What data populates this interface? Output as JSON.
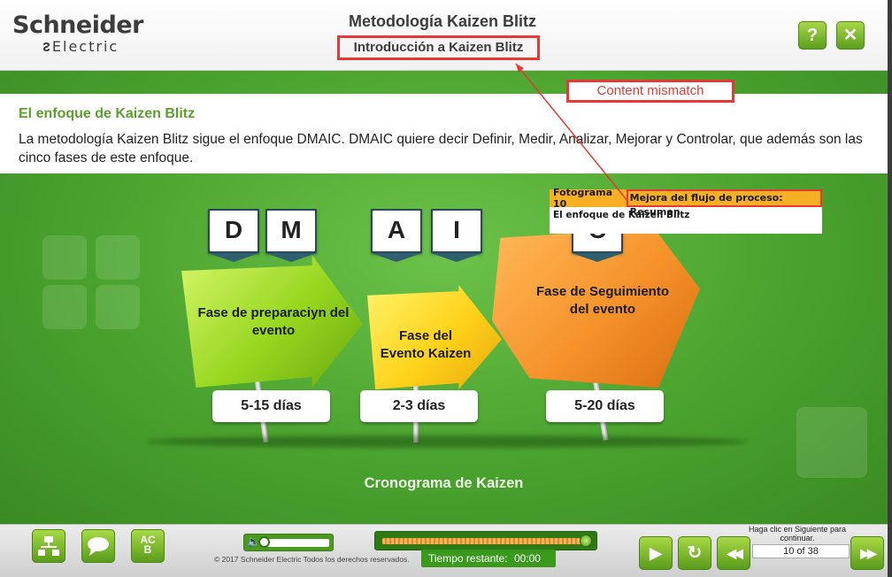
{
  "header": {
    "logo_line1": "Schneider",
    "logo_line2": "Electric",
    "course_title": "Metodología Kaizen Blitz",
    "slide_title": "Introducción a Kaizen Blitz",
    "help_label": "?",
    "close_label": "✕"
  },
  "annotation": {
    "label": "Content mismatch",
    "color": "#e53935"
  },
  "intro": {
    "heading": "El enfoque de Kaizen Blitz",
    "body": "La metodología Kaizen Blitz sigue el enfoque DMAIC. DMAIC quiere decir Definir, Medir, Analizar, Mejorar y Controlar, que además son las cinco fases de este enfoque."
  },
  "diagram": {
    "letters": [
      "D",
      "M",
      "A",
      "I",
      "C"
    ],
    "phases": [
      {
        "label": "Fase de preparaciyn del evento",
        "duration": "5-15 días",
        "color": "#95d61e"
      },
      {
        "label": "Fase del Evento Kaizen",
        "duration": "2-3 días",
        "color": "#ffd21a"
      },
      {
        "label": "Fase de Seguimiento del evento",
        "duration": "5-20 días",
        "color": "#f5922a"
      }
    ],
    "caption": "Cronograma de Kaizen"
  },
  "overlay": {
    "frame_label": "Fotograma 10",
    "frame_title": "Mejora del flujo de proceso: Resumen",
    "frame_subtitle": "El enfoque de Kaizen Blitz"
  },
  "footer": {
    "glossary_label_top": "AC",
    "glossary_label_bottom": "B",
    "copyright": "© 2017 Schneider Electric Todos los derechos reservados.",
    "time_label": "Tiempo restante:",
    "time_value": "00:00",
    "hint": "Haga clic en Siguiente para continuar.",
    "page_indicator": "10 of 38",
    "progress": 1.0,
    "volume": 0.0
  },
  "colors": {
    "brand_green": "#5aa02c",
    "stage_green": "#4aa32e",
    "overlay_orange": "#f7b024"
  }
}
